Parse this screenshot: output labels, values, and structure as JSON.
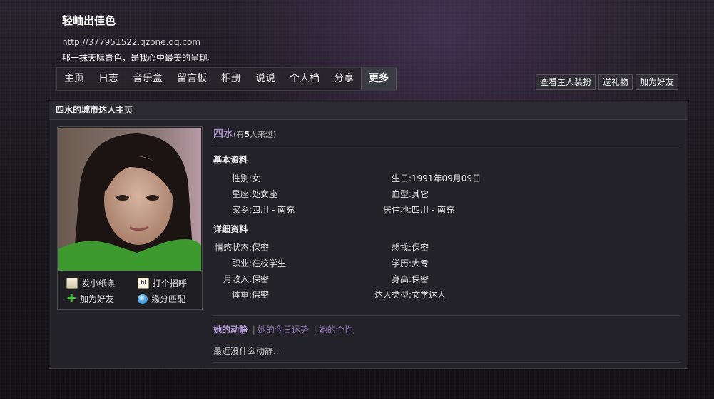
{
  "header": {
    "title": "轻岫出佳色",
    "url": "http://377951522.qzone.qq.com",
    "motto": "那一抹天际青色，是我心中最美的呈现。"
  },
  "nav": {
    "tabs": [
      "主页",
      "日志",
      "音乐盒",
      "留言板",
      "相册",
      "说说",
      "个人档",
      "分享",
      "更多"
    ],
    "active_index": 8
  },
  "actions": {
    "view_decor": "查看主人装扮",
    "send_gift": "送礼物",
    "add_friend": "加为好友"
  },
  "panel": {
    "title": "四水的城市达人主页"
  },
  "photo_actions": {
    "send_note": "发小纸条",
    "greet": "打个招呼",
    "add_friend": "加为好友",
    "match": "缘分匹配"
  },
  "profile": {
    "name": "四水",
    "visits_prefix": "(有",
    "visits_count": "5",
    "visits_suffix": "人来过)",
    "basic_title": "基本资料",
    "basic": {
      "gender_label": "性别:",
      "gender": "女",
      "birthday_label": "生日:",
      "birthday": "1991年09月09日",
      "zodiac_label": "星座:",
      "zodiac": "处女座",
      "blood_label": "血型:",
      "blood": "其它",
      "hometown_label": "家乡:",
      "hometown": "四川 - 南充",
      "residence_label": "居住地:",
      "residence": "四川 - 南充"
    },
    "detail_title": "详细资料",
    "detail": {
      "relationship_label": "情感状态:",
      "relationship": "保密",
      "seeking_label": "想找:",
      "seeking": "保密",
      "job_label": "职业:",
      "job": "在校学生",
      "education_label": "学历:",
      "education": "大专",
      "income_label": "月收入:",
      "income": "保密",
      "height_label": "身高:",
      "height": "保密",
      "weight_label": "体重:",
      "weight": "保密",
      "expert_label": "达人类型:",
      "expert": "文学达人"
    }
  },
  "feed": {
    "tab_activity": "她的动静",
    "tab_fortune": "她的今日运势",
    "tab_personality": "她的个性",
    "separator": "|",
    "empty_text": "最近没什么动静..."
  },
  "colors": {
    "accent_purple": "#a38fc4",
    "panel_bg": "#232228",
    "page_bg": "#1a171c"
  }
}
